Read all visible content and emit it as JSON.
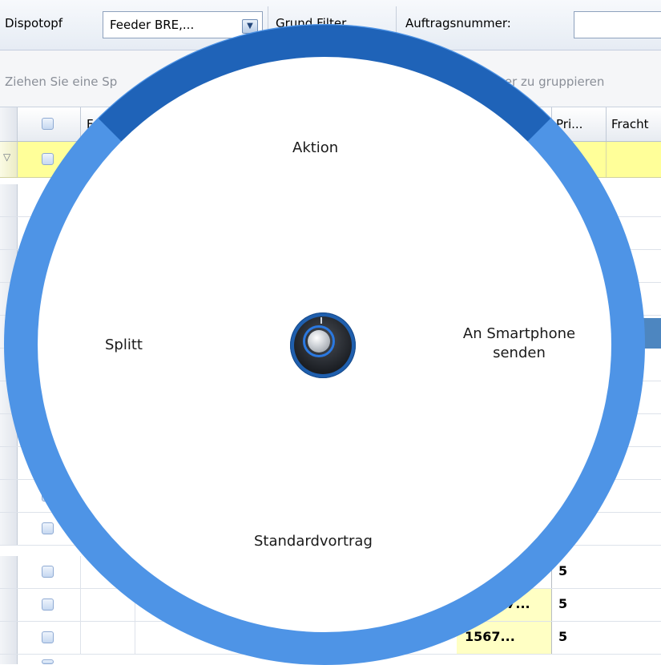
{
  "toolbar": {
    "dispotopf_label": "Dispotopf",
    "dispotopf_value": "Feeder BRE,...",
    "grund_filter_label": "Grund Filter",
    "order_number_label": "Auftragsnummer:",
    "order_number_value": ""
  },
  "group_panel": {
    "hint_left": "Ziehen Sie eine Sp",
    "hint_right": "ser zu gruppieren"
  },
  "grid": {
    "headers": {
      "col_f": "F",
      "priority": "Pri...",
      "freight": "Fracht"
    },
    "rows": [
      {
        "number": "",
        "priority": "5"
      },
      {
        "number": "...7...",
        "priority": "5"
      },
      {
        "number": "1567...",
        "priority": "5"
      }
    ]
  },
  "radial_menu": {
    "top": "Aktion",
    "left": "Splitt",
    "right_line1": "An Smartphone",
    "right_line2": "senden",
    "bottom": "Standardvortrag"
  },
  "colors": {
    "ring": "#4e94e6",
    "ring_active": "#1f63b8",
    "filter_row": "#ffff99"
  }
}
